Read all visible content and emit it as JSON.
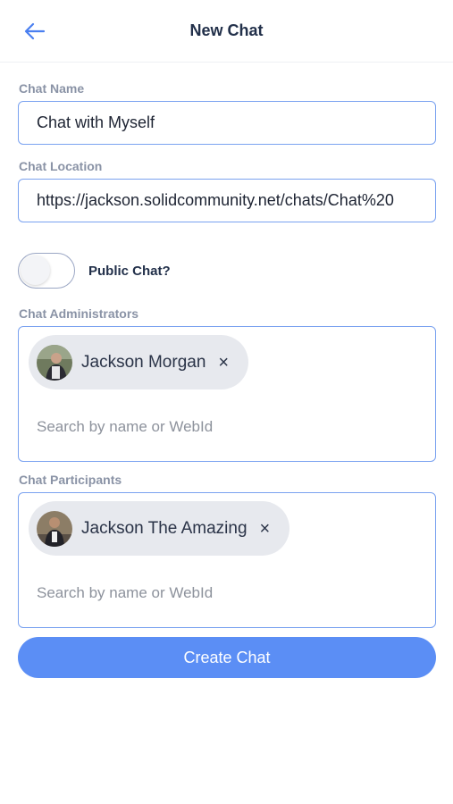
{
  "header": {
    "title": "New Chat",
    "back_icon": "arrow-left-icon"
  },
  "form": {
    "chat_name": {
      "label": "Chat Name",
      "value": "Chat with Myself"
    },
    "chat_location": {
      "label": "Chat Location",
      "value": "https://jackson.solidcommunity.net/chats/Chat%20"
    },
    "public_chat": {
      "label": "Public Chat?",
      "enabled": false
    },
    "administrators": {
      "label": "Chat Administrators",
      "chips": [
        {
          "name": "Jackson Morgan",
          "remove": "×"
        }
      ],
      "placeholder": "Search by name or WebId"
    },
    "participants": {
      "label": "Chat Participants",
      "chips": [
        {
          "name": "Jackson The Amazing",
          "remove": "×"
        }
      ],
      "placeholder": "Search by name or WebId"
    }
  },
  "create_button": {
    "label": "Create Chat"
  },
  "colors": {
    "accent": "#5b8ef5",
    "field_border": "#7aa2f0",
    "label": "#8a93a6",
    "chip_bg": "#e7e9ee"
  }
}
